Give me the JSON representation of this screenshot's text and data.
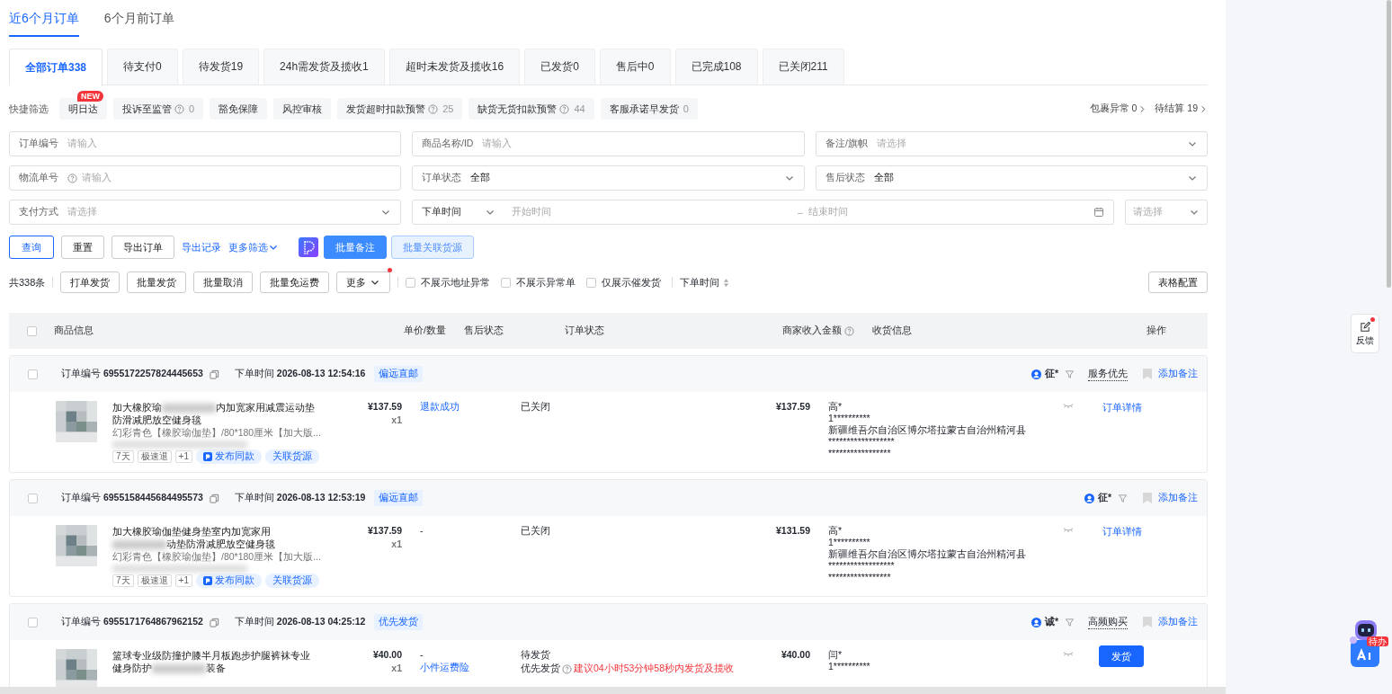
{
  "period_tabs": [
    {
      "label": "近6个月订单",
      "selected": true
    },
    {
      "label": "6个月前订单",
      "selected": false
    }
  ],
  "status_tabs": [
    {
      "label": "全部订单338",
      "selected": true
    },
    {
      "label": "待支付0",
      "selected": false
    },
    {
      "label": "待发货19",
      "selected": false
    },
    {
      "label": "24h需发货及揽收1",
      "selected": false
    },
    {
      "label": "超时未发货及揽收16",
      "selected": false
    },
    {
      "label": "已发货0",
      "selected": false
    },
    {
      "label": "售后中0",
      "selected": false
    },
    {
      "label": "已完成108",
      "selected": false
    },
    {
      "label": "已关闭211",
      "selected": false
    }
  ],
  "quick_filter": {
    "label": "快捷筛选",
    "chips": [
      {
        "label": "明日达",
        "badge": "NEW"
      },
      {
        "label": "投诉至监管",
        "help": true,
        "count": "0"
      },
      {
        "label": "豁免保障"
      },
      {
        "label": "风控审核"
      },
      {
        "label": "发货超时扣款预警",
        "help": true,
        "count": "25"
      },
      {
        "label": "缺货无货扣款预警",
        "help": true,
        "count": "44"
      },
      {
        "label": "客服承诺早发货",
        "count": "0"
      }
    ],
    "links": [
      {
        "label": "包裹异常",
        "count": "0"
      },
      {
        "label": "待结算",
        "count": "19"
      }
    ]
  },
  "filters": [
    {
      "kind": "input",
      "label": "订单编号",
      "placeholder": "请输入"
    },
    {
      "kind": "input",
      "label": "商品名称/ID",
      "placeholder": "请输入"
    },
    {
      "kind": "select",
      "label": "备注/旗帜",
      "placeholder": "请选择"
    },
    {
      "kind": "input",
      "label": "物流单号",
      "help": true,
      "placeholder": "请输入"
    },
    {
      "kind": "select",
      "label": "订单状态",
      "value": "全部"
    },
    {
      "kind": "select",
      "label": "售后状态",
      "value": "全部"
    },
    {
      "kind": "select",
      "label": "支付方式",
      "placeholder": "请选择"
    },
    {
      "kind": "daterange",
      "label": "下单时间",
      "start_placeholder": "开始时间",
      "separator": "–",
      "end_placeholder": "结束时间"
    },
    {
      "kind": "select",
      "placeholder": "请选择"
    }
  ],
  "actions": [
    {
      "kind": "outline",
      "label": "查询"
    },
    {
      "kind": "default",
      "label": "重置"
    },
    {
      "kind": "default",
      "label": "导出订单"
    },
    {
      "kind": "link",
      "label": "导出记录"
    },
    {
      "kind": "dropdown-link",
      "label": "更多筛选"
    },
    {
      "kind": "app-icon"
    },
    {
      "kind": "primary",
      "label": "批量备注"
    },
    {
      "kind": "light",
      "label": "批量关联货源"
    }
  ],
  "toolbar": {
    "total": "共338条",
    "buttons": [
      {
        "label": "打单发货"
      },
      {
        "label": "批量发货"
      },
      {
        "label": "批量取消"
      },
      {
        "label": "批量免运费"
      },
      {
        "label": "更多",
        "dropdown": true,
        "dot": true
      }
    ],
    "checkboxes": [
      {
        "label": "不展示地址异常",
        "checked": false
      },
      {
        "label": "不展示异常单",
        "checked": false
      },
      {
        "label": "仅展示催发货",
        "checked": false
      }
    ],
    "sort": "下单时间",
    "config": "表格配置"
  },
  "table": {
    "select_all_checked": false,
    "columns": [
      {
        "label": "商品信息"
      },
      {
        "label": "单价/数量"
      },
      {
        "label": "售后状态"
      },
      {
        "label": "订单状态"
      },
      {
        "label": "商家收入金额",
        "help": true
      },
      {
        "label": "收货信息"
      },
      {
        "label": "操作"
      }
    ],
    "orders": [
      {
        "order_no_label": "订单编号",
        "order_no": "6955172257824445653",
        "time_label": "下单时间",
        "time": "2026-08-13 12:54:16",
        "tag": "偏远直邮",
        "buyer": "征*",
        "buyer_tag": "服务优先",
        "note": "添加备注",
        "title_start": "加大橡胶瑜",
        "title_end": "内加宽家用减震运动垫防滑减肥放空健身毯",
        "sku": "幻彩青色【橡胶瑜伽垫】/80*180厘米【加大版...",
        "service_tags": [
          "7天",
          "极速退",
          "+1"
        ],
        "publish": "发布同款",
        "source": "关联货源",
        "checked": false,
        "price": "¥137.59",
        "qty": "x1",
        "after_sale": "退款成功",
        "after_sale_highlighted": true,
        "status": "已关闭",
        "income": "¥137.59",
        "recipient": {
          "name": "高*",
          "phone": "1**********",
          "address": "新疆维吾尔自治区博尔塔拉蒙古自治州精河县 ******************",
          "address_more": "*****************"
        },
        "action": {
          "kind": "link",
          "label": "订单详情"
        }
      },
      {
        "order_no_label": "订单编号",
        "order_no": "6955158445684495573",
        "time_label": "下单时间",
        "time": "2026-08-13 12:53:19",
        "tag": "偏远直邮",
        "buyer": "征*",
        "note": "添加备注",
        "title_start": "加大橡胶瑜伽垫健身垫室内加宽家用",
        "title_end": "动垫防滑减肥放空健身毯",
        "sku": "幻彩青色【橡胶瑜伽垫】/80*180厘米【加大版...",
        "service_tags": [
          "7天",
          "极速退",
          "+1"
        ],
        "publish": "发布同款",
        "source": "关联货源",
        "checked": false,
        "price": "¥137.59",
        "qty": "x1",
        "after_sale": "-",
        "after_sale_highlighted": false,
        "status": "已关闭",
        "income": "¥131.59",
        "recipient": {
          "name": "高*",
          "phone": "1**********",
          "address": "新疆维吾尔自治区博尔塔拉蒙古自治州精河县 ******************",
          "address_more": "*****************"
        },
        "action": {
          "kind": "link",
          "label": "订单详情"
        }
      },
      {
        "order_no_label": "订单编号",
        "order_no": "6955171764867962152",
        "time_label": "下单时间",
        "time": "2026-08-13 04:25:12",
        "tag": "优先发货",
        "buyer": "诚*",
        "buyer_tag": "高频购买",
        "note": "添加备注",
        "title_start": "篮球专业级防撞护膝半月板跑步护腿裤袜专业健身防护",
        "title_end": "装备",
        "checked": false,
        "price": "¥40.00",
        "qty": "x1",
        "after_sale": "-",
        "after_sale_extra": "小件运费险",
        "after_sale_highlighted": false,
        "status": "待发货",
        "status_note": "优先发货",
        "status_warning": "建议04小时53分钟58秒内发货及揽收",
        "income": "¥40.00",
        "recipient": {
          "name": "闫*",
          "phone": "1**********"
        },
        "action": {
          "kind": "button",
          "label": "发货"
        }
      }
    ]
  },
  "feedback": "反馈",
  "assistant": {
    "badge": "待办"
  }
}
